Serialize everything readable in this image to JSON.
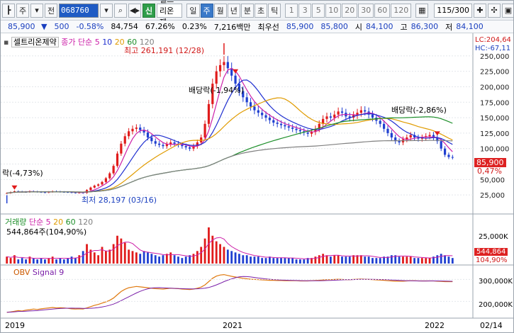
{
  "toolbar": {
    "type_label": "주",
    "kind_label": "전",
    "code": "068760",
    "sin_label": "신",
    "stock_name": "셀트리온제",
    "periods": [
      "일",
      "주",
      "월",
      "년",
      "분",
      "초",
      "틱"
    ],
    "selected_period": "주",
    "minutes": [
      "1",
      "3",
      "5",
      "10",
      "20",
      "30",
      "60",
      "120"
    ],
    "page": "115",
    "page_total": "/300"
  },
  "quote": {
    "price": "85,900",
    "change": "500",
    "change_pct": "-0.58%",
    "volume": "84,754",
    "ratio": "67.26%",
    "turnover": "0.23%",
    "amount": "7,216백만",
    "best_ask_label": "최우선",
    "ask": "85,900",
    "bid": "85,800",
    "open_label": "시",
    "open": "84,100",
    "high_label": "고",
    "high": "86,300",
    "low_label": "저",
    "low": "84,100"
  },
  "price_panel": {
    "name": "셀트리온제약",
    "ma_label": "종가 단순",
    "ma_periods": [
      "5",
      "10",
      "20",
      "60",
      "120"
    ],
    "ma_colors": [
      "#cc1fa8",
      "#1f2fd0",
      "#e09b00",
      "#1d8f2a",
      "#808080"
    ],
    "lc": "LC:204,64",
    "hc": "HC:-67,11",
    "high_note": "최고 261,191 (12/28)",
    "low_note": "최저 28,197 (03/16)",
    "div_note_left": "락(-4,73%)",
    "div_note_mid": "배당락(-1,94%)",
    "div_note_right": "배당락(-2,86%)",
    "price_tag": "85,900",
    "pct_tag": "0,47%",
    "y_ticks": [
      "250,000",
      "225,000",
      "200,000",
      "175,000",
      "150,000",
      "125,000",
      "100,000",
      "75,000",
      "50,000",
      "25,000"
    ]
  },
  "volume_panel": {
    "title": "거래량",
    "ma_label": "단순",
    "ma_periods": [
      "5",
      "20",
      "60",
      "120"
    ],
    "value_text": "544,864주(104,90%)",
    "y_tick": "25,000K",
    "vol_tag": "544,864",
    "vol_pct_tag": "104,90%"
  },
  "obv_panel": {
    "title": "OBV",
    "signal": "Signal 9",
    "y_ticks": [
      "300,000K",
      "200,000K"
    ]
  },
  "x_axis": {
    "labels": [
      "2019",
      "2021",
      "2022",
      "02/14"
    ]
  },
  "chart_data": {
    "type": "candlestick",
    "ylim": [
      0,
      275000
    ],
    "closes": [
      28000,
      29500,
      31000,
      30500,
      30000,
      29800,
      31000,
      30500,
      30000,
      29500,
      29000,
      30000,
      31000,
      30500,
      30000,
      29800,
      29500,
      29000,
      28500,
      29000,
      28197,
      33000,
      37000,
      40000,
      42000,
      46000,
      52000,
      60000,
      72000,
      92000,
      108000,
      120000,
      128000,
      132000,
      134000,
      130000,
      126000,
      118000,
      112000,
      108000,
      106000,
      104000,
      107000,
      110000,
      108000,
      106000,
      104000,
      102000,
      100000,
      104000,
      110000,
      118000,
      140000,
      172000,
      205000,
      225000,
      235000,
      240000,
      230000,
      218000,
      205000,
      193000,
      183000,
      175000,
      168000,
      162000,
      158000,
      154000,
      150000,
      146000,
      142000,
      140000,
      138000,
      136000,
      134000,
      132000,
      130000,
      128000,
      126000,
      124000,
      127000,
      132000,
      140000,
      148000,
      152000,
      150000,
      155000,
      160000,
      158000,
      152000,
      150000,
      154000,
      158000,
      162000,
      160000,
      155000,
      150000,
      145000,
      140000,
      132000,
      125000,
      118000,
      112000,
      110000,
      115000,
      118000,
      122000,
      118000,
      116000,
      118000,
      120000,
      122000,
      118000,
      112000,
      100000,
      90000,
      86400,
      85900
    ],
    "volume": [
      5,
      4,
      6,
      3,
      4,
      3,
      5,
      4,
      3,
      4,
      3,
      4,
      5,
      3,
      4,
      3,
      4,
      5,
      4,
      6,
      9,
      14,
      10,
      8,
      6,
      12,
      9,
      10,
      14,
      20,
      18,
      15,
      10,
      9,
      8,
      7,
      9,
      8,
      7,
      6,
      5,
      6,
      7,
      8,
      6,
      5,
      4,
      5,
      6,
      7,
      9,
      12,
      18,
      26,
      20,
      16,
      14,
      12,
      10,
      9,
      8,
      7,
      6,
      6,
      5,
      5,
      5,
      4,
      4,
      5,
      4,
      4,
      4,
      4,
      4,
      4,
      3,
      3,
      3,
      4,
      4,
      5,
      6,
      7,
      6,
      5,
      6,
      6,
      5,
      5,
      5,
      6,
      6,
      6,
      5,
      5,
      4,
      4,
      4,
      5,
      5,
      6,
      6,
      5,
      5,
      5,
      5,
      4,
      4,
      4,
      4,
      4,
      5,
      6,
      7,
      6,
      5,
      4
    ],
    "obv": [
      150,
      152,
      155,
      158,
      156,
      160,
      162,
      165,
      163,
      166,
      168,
      170,
      172,
      170,
      171,
      170,
      168,
      166,
      165,
      166,
      165,
      170,
      176,
      182,
      186,
      192,
      198,
      205,
      215,
      230,
      245,
      255,
      262,
      265,
      268,
      266,
      264,
      262,
      260,
      258,
      257,
      256,
      258,
      260,
      259,
      258,
      256,
      255,
      254,
      256,
      260,
      265,
      275,
      290,
      305,
      315,
      320,
      322,
      318,
      314,
      311,
      308,
      305,
      303,
      301,
      300,
      299,
      298,
      297,
      296,
      296,
      295,
      295,
      294,
      294,
      294,
      294,
      293,
      293,
      293,
      294,
      295,
      296,
      298,
      299,
      299,
      300,
      301,
      300,
      299,
      299,
      300,
      301,
      302,
      301,
      300,
      299,
      298,
      297,
      296,
      294,
      293,
      292,
      292,
      292,
      293,
      294,
      294,
      293,
      293,
      293,
      293,
      293,
      292,
      291,
      290,
      290,
      290
    ]
  }
}
